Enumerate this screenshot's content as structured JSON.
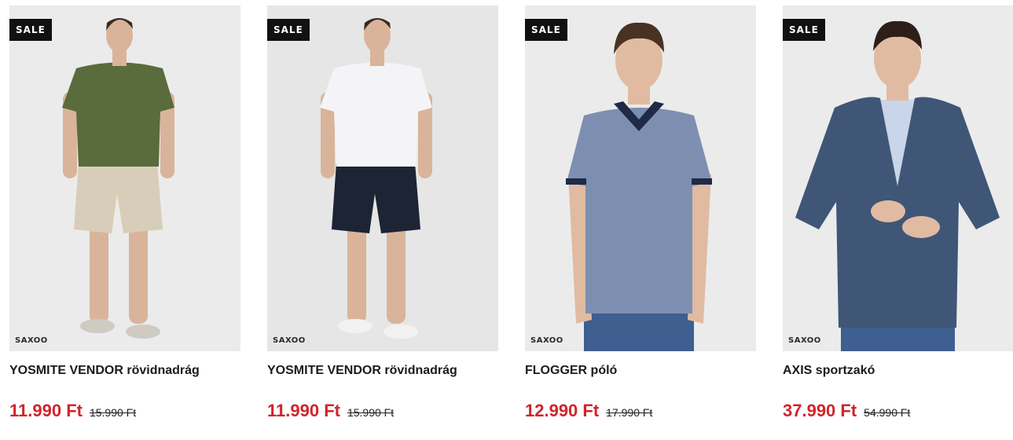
{
  "products": [
    {
      "badge": "SALE",
      "brand": "SAXOO",
      "title": "YOSMITE VENDOR rövidnadrág",
      "price_current": "11.990 Ft",
      "price_old": "15.990 Ft",
      "image": {
        "shirt_color": "#5a6b3c",
        "bottom_color": "#d8cdb8",
        "skin_color": "#d9b49a",
        "hair_color": "#3b2a20",
        "shoe_color": "#cfcac2",
        "bg_color": "#ebebeb"
      }
    },
    {
      "badge": "SALE",
      "brand": "SAXOO",
      "title": "YOSMITE VENDOR rövidnadrág",
      "price_current": "11.990 Ft",
      "price_old": "15.990 Ft",
      "image": {
        "shirt_color": "#f4f4f6",
        "bottom_color": "#1d2434",
        "skin_color": "#d9b49a",
        "hair_color": "#3b2a20",
        "shoe_color": "#f2f2f2",
        "bg_color": "#e6e6e6"
      }
    },
    {
      "badge": "SALE",
      "brand": "SAXOO",
      "title": "FLOGGER póló",
      "price_current": "12.990 Ft",
      "price_old": "17.990 Ft",
      "image": {
        "shirt_color": "#7d8fb0",
        "bottom_color": "#3e5f8f",
        "skin_color": "#e0bba2",
        "hair_color": "#4a3222",
        "collar_color": "#1f2a47",
        "bg_color": "#ebebeb"
      }
    },
    {
      "badge": "SALE",
      "brand": "SAXOO",
      "title": "AXIS sportzakó",
      "price_current": "37.990 Ft",
      "price_old": "54.990 Ft",
      "image": {
        "shirt_color": "#3f5677",
        "bottom_color": "#3e5f8f",
        "skin_color": "#e0bba2",
        "hair_color": "#2c2018",
        "inner_shirt_color": "#c9d5e8",
        "bg_color": "#ebebeb"
      }
    }
  ]
}
